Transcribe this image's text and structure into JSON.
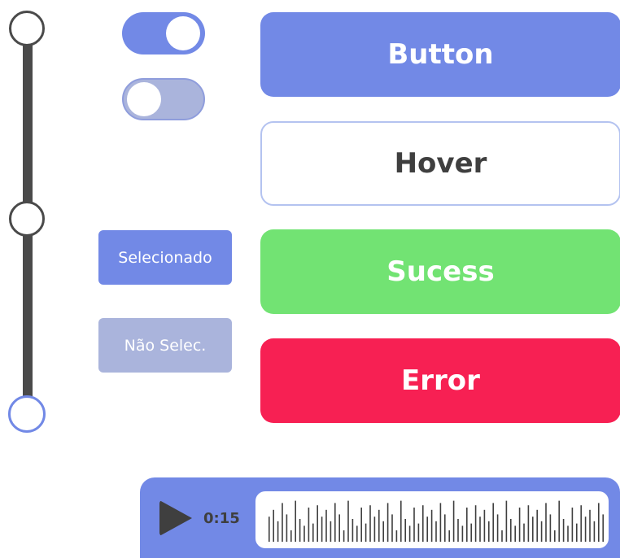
{
  "colors": {
    "primary": "#7289e6",
    "primary_light": "#aab4dc",
    "success": "#72e373",
    "error": "#f72053",
    "dark": "#4a4a4a",
    "hover_border": "#b4c3f0",
    "text_dark": "#3f3f3f"
  },
  "slider": {
    "stops": 3,
    "selected_stop": 3
  },
  "toggles": [
    {
      "state": "on"
    },
    {
      "state": "off"
    }
  ],
  "select_boxes": [
    {
      "label": "Selecionado",
      "state": "selected"
    },
    {
      "label": "Não Selec.",
      "state": "unselected"
    }
  ],
  "buttons": {
    "primary": "Button",
    "hover": "Hover",
    "success": "Sucess",
    "error": "Error"
  },
  "audio": {
    "time": "0:15",
    "icon": "play-icon"
  }
}
